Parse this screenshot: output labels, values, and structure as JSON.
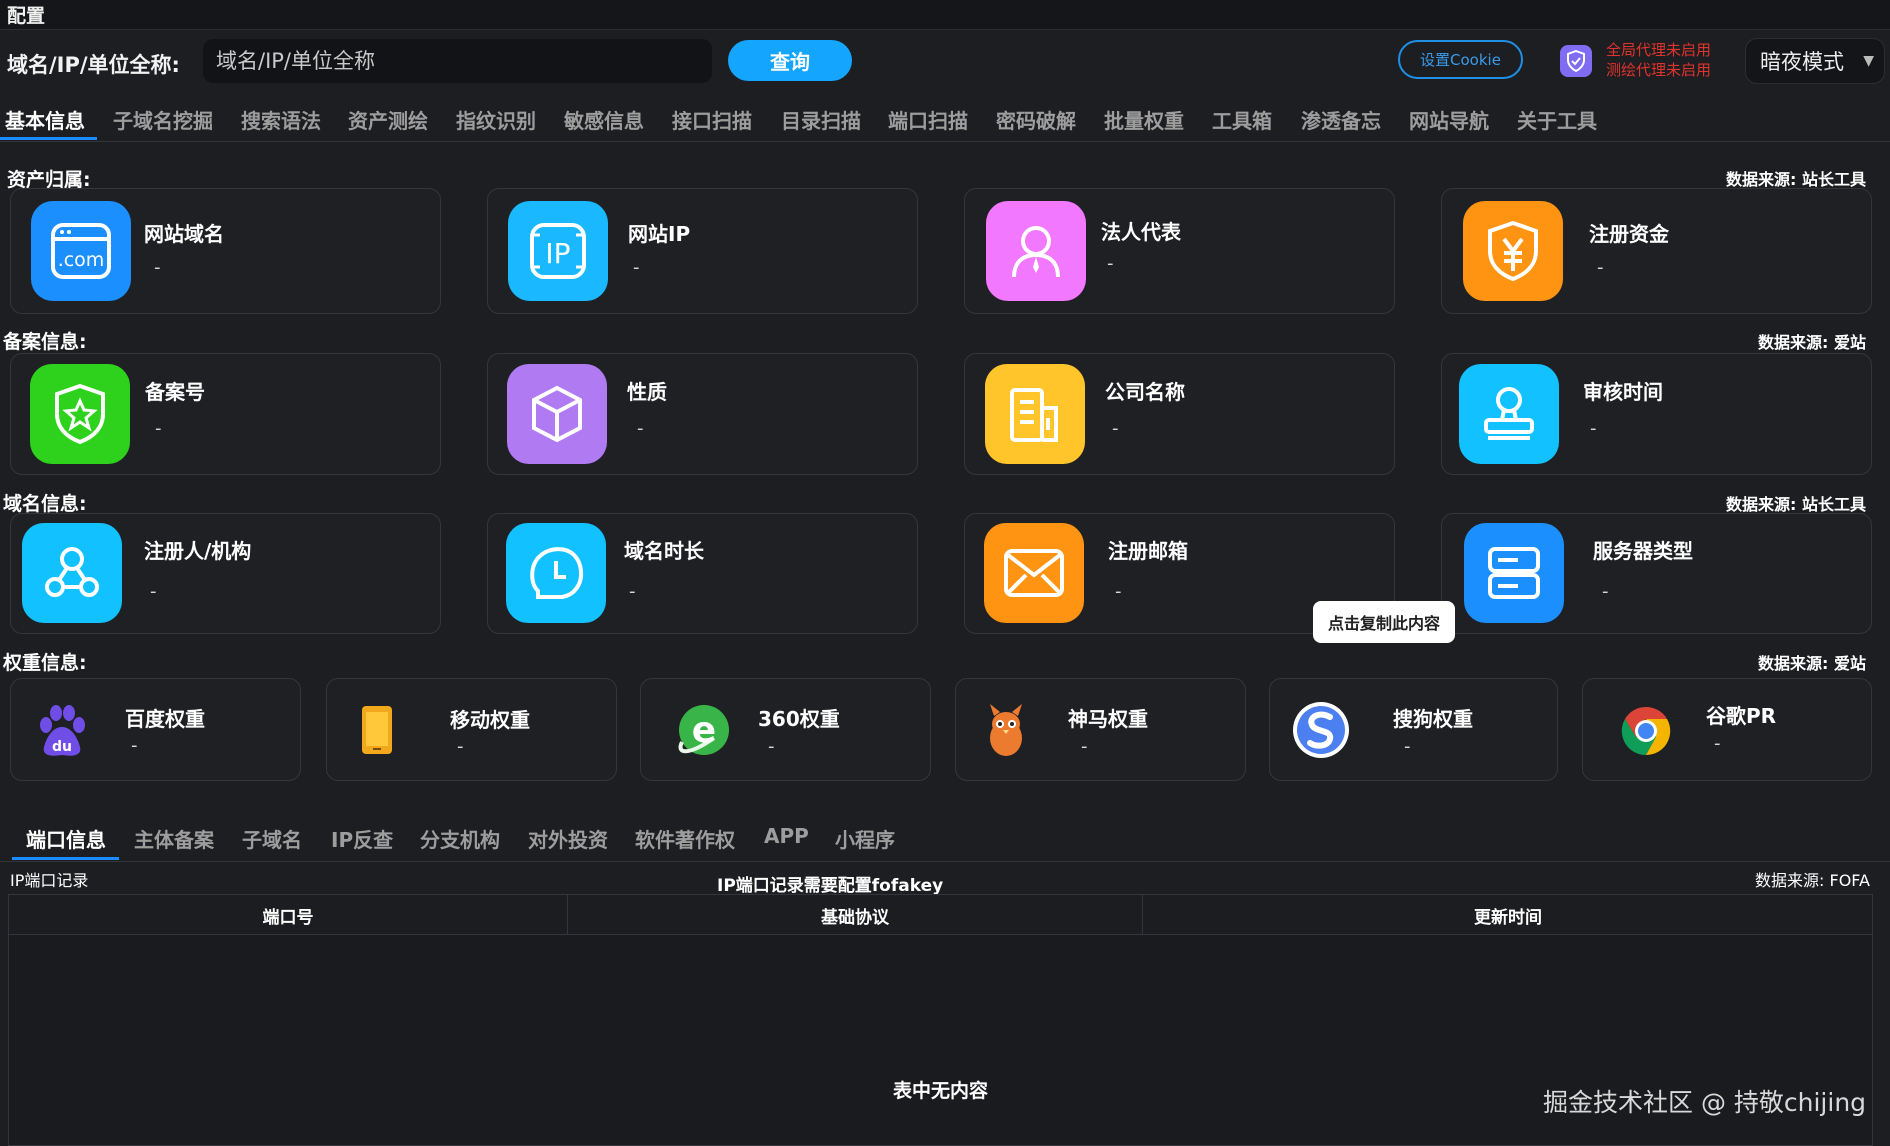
{
  "menu": {
    "title": "配置"
  },
  "query": {
    "label": "域名/IP/单位全称:",
    "placeholder": "域名/IP/单位全称",
    "button": "查询"
  },
  "header": {
    "cookie_button": "设置Cookie",
    "proxy_global": "全局代理未启用",
    "proxy_test": "测绘代理未启用",
    "mode": "暗夜模式"
  },
  "tabs": [
    "基本信息",
    "子域名挖掘",
    "搜索语法",
    "资产测绘",
    "指纹识别",
    "敏感信息",
    "接口扫描",
    "目录扫描",
    "端口扫描",
    "密码破解",
    "批量权重",
    "工具箱",
    "渗透备忘",
    "网站导航",
    "关于工具"
  ],
  "sections": {
    "asset": {
      "title": "资产归属:",
      "source": "数据来源: 站长工具",
      "cards": [
        {
          "title": "网站域名",
          "value": "-",
          "icon": "www-icon",
          "color": "#1c8fff"
        },
        {
          "title": "网站IP",
          "value": "-",
          "icon": "ip-icon",
          "color": "#19b8ff"
        },
        {
          "title": "法人代表",
          "value": "-",
          "icon": "person-icon",
          "color": "#f279ff"
        },
        {
          "title": "注册资金",
          "value": "-",
          "icon": "yen-shield-icon",
          "color": "#ff9412"
        }
      ]
    },
    "icp": {
      "title": "备案信息:",
      "source": "数据来源: 爱站",
      "cards": [
        {
          "title": "备案号",
          "value": "-",
          "icon": "star-shield-icon",
          "color": "#2ed21d"
        },
        {
          "title": "性质",
          "value": "-",
          "icon": "cube-icon",
          "color": "#b07af2"
        },
        {
          "title": "公司名称",
          "value": "-",
          "icon": "building-icon",
          "color": "#ffc52a"
        },
        {
          "title": "审核时间",
          "value": "-",
          "icon": "stamp-icon",
          "color": "#12c1ff"
        }
      ]
    },
    "domain": {
      "title": "域名信息:",
      "source": "数据来源: 站长工具",
      "cards": [
        {
          "title": "注册人/机构",
          "value": "-",
          "icon": "registrant-icon",
          "color": "#12c1ff"
        },
        {
          "title": "域名时长",
          "value": "-",
          "icon": "clock-icon",
          "color": "#12c1ff"
        },
        {
          "title": "注册邮箱",
          "value": "-",
          "icon": "mail-icon",
          "color": "#ff9412"
        },
        {
          "title": "服务器类型",
          "value": "-",
          "icon": "server-icon",
          "color": "#1c8fff"
        }
      ]
    },
    "weight": {
      "title": "权重信息:",
      "source": "数据来源: 爱站",
      "cards": [
        {
          "title": "百度权重",
          "value": "-",
          "icon": "baidu-icon"
        },
        {
          "title": "移动权重",
          "value": "-",
          "icon": "mobile-icon"
        },
        {
          "title": "360权重",
          "value": "-",
          "icon": "360-icon"
        },
        {
          "title": "神马权重",
          "value": "-",
          "icon": "shenma-icon"
        },
        {
          "title": "搜狗权重",
          "value": "-",
          "icon": "sogou-icon"
        },
        {
          "title": "谷歌PR",
          "value": "-",
          "icon": "chrome-icon"
        }
      ]
    }
  },
  "tooltip": "点击复制此内容",
  "bottom": {
    "tabs": [
      "端口信息",
      "主体备案",
      "子域名",
      "IP反查",
      "分支机构",
      "对外投资",
      "软件著作权",
      "APP",
      "小程序"
    ],
    "title": "IP端口记录",
    "notice": "IP端口记录需要配置fofakey",
    "source": "数据来源: FOFA",
    "columns": [
      "端口号",
      "基础协议",
      "更新时间"
    ],
    "empty": "表中无内容"
  },
  "watermark": "掘金技术社区 @ 持敬chijing"
}
